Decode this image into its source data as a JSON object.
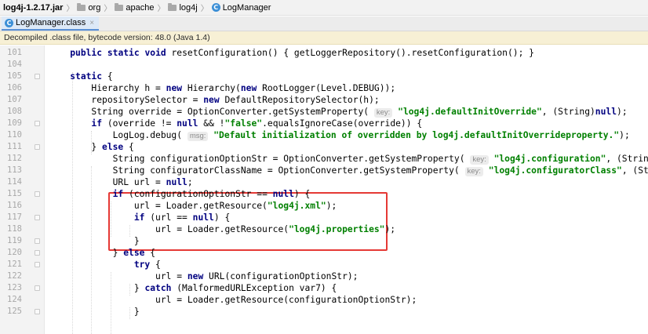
{
  "breadcrumb": {
    "items": [
      {
        "label": "log4j-1.2.17.jar",
        "icon": "none"
      },
      {
        "label": "org",
        "icon": "folder-icon"
      },
      {
        "label": "apache",
        "icon": "folder-icon"
      },
      {
        "label": "log4j",
        "icon": "folder-icon"
      },
      {
        "label": "LogManager",
        "icon": "class-icon"
      }
    ],
    "separator": "〉",
    "class_icon_letter": "C"
  },
  "tab": {
    "label": "LogManager.class",
    "close": "×",
    "icon_letter": "C"
  },
  "banner": {
    "text": "Decompiled .class file, bytecode version: 48.0 (Java 1.4)"
  },
  "code": {
    "lines": [
      {
        "n": "101",
        "t": "    public static void resetConfiguration() { getLoggerRepository().resetConfiguration(); }"
      },
      {
        "n": "104",
        "t": ""
      },
      {
        "n": "105",
        "t": "    static {"
      },
      {
        "n": "106",
        "t": "        Hierarchy h = new Hierarchy(new RootLogger(Level.DEBUG));"
      },
      {
        "n": "107",
        "t": "        repositorySelector = new DefaultRepositorySelector(h);"
      },
      {
        "n": "108",
        "t": "        String override = OptionConverter.getSystemProperty( key: \"log4j.defaultInitOverride\", (String)null);"
      },
      {
        "n": "109",
        "t": "        if (override != null && !\"false\".equalsIgnoreCase(override)) {"
      },
      {
        "n": "110",
        "t": "            LogLog.debug( msg: \"Default initialization of overridden by log4j.defaultInitOverrideproperty.\");"
      },
      {
        "n": "111",
        "t": "        } else {"
      },
      {
        "n": "112",
        "t": "            String configurationOptionStr = OptionConverter.getSystemProperty( key: \"log4j.configuration\", (String)null);"
      },
      {
        "n": "113",
        "t": "            String configuratorClassName = OptionConverter.getSystemProperty( key: \"log4j.configuratorClass\", (String)null);"
      },
      {
        "n": "114",
        "t": "            URL url = null;"
      },
      {
        "n": "115",
        "t": "            if (configurationOptionStr == null) {"
      },
      {
        "n": "116",
        "t": "                url = Loader.getResource(\"log4j.xml\");"
      },
      {
        "n": "117",
        "t": "                if (url == null) {"
      },
      {
        "n": "118",
        "t": "                    url = Loader.getResource(\"log4j.properties\");"
      },
      {
        "n": "119",
        "t": "                }"
      },
      {
        "n": "120",
        "t": "            } else {"
      },
      {
        "n": "121",
        "t": "                try {"
      },
      {
        "n": "122",
        "t": "                    url = new URL(configurationOptionStr);"
      },
      {
        "n": "123",
        "t": "                } catch (MalformedURLException var7) {"
      },
      {
        "n": "124",
        "t": "                    url = Loader.getResource(configurationOptionStr);"
      },
      {
        "n": "125",
        "t": "                }"
      }
    ]
  },
  "colors": {
    "keyword": "#000080",
    "string": "#008000",
    "highlight_box": "#e53935",
    "banner_bg": "#f7f0d5"
  }
}
